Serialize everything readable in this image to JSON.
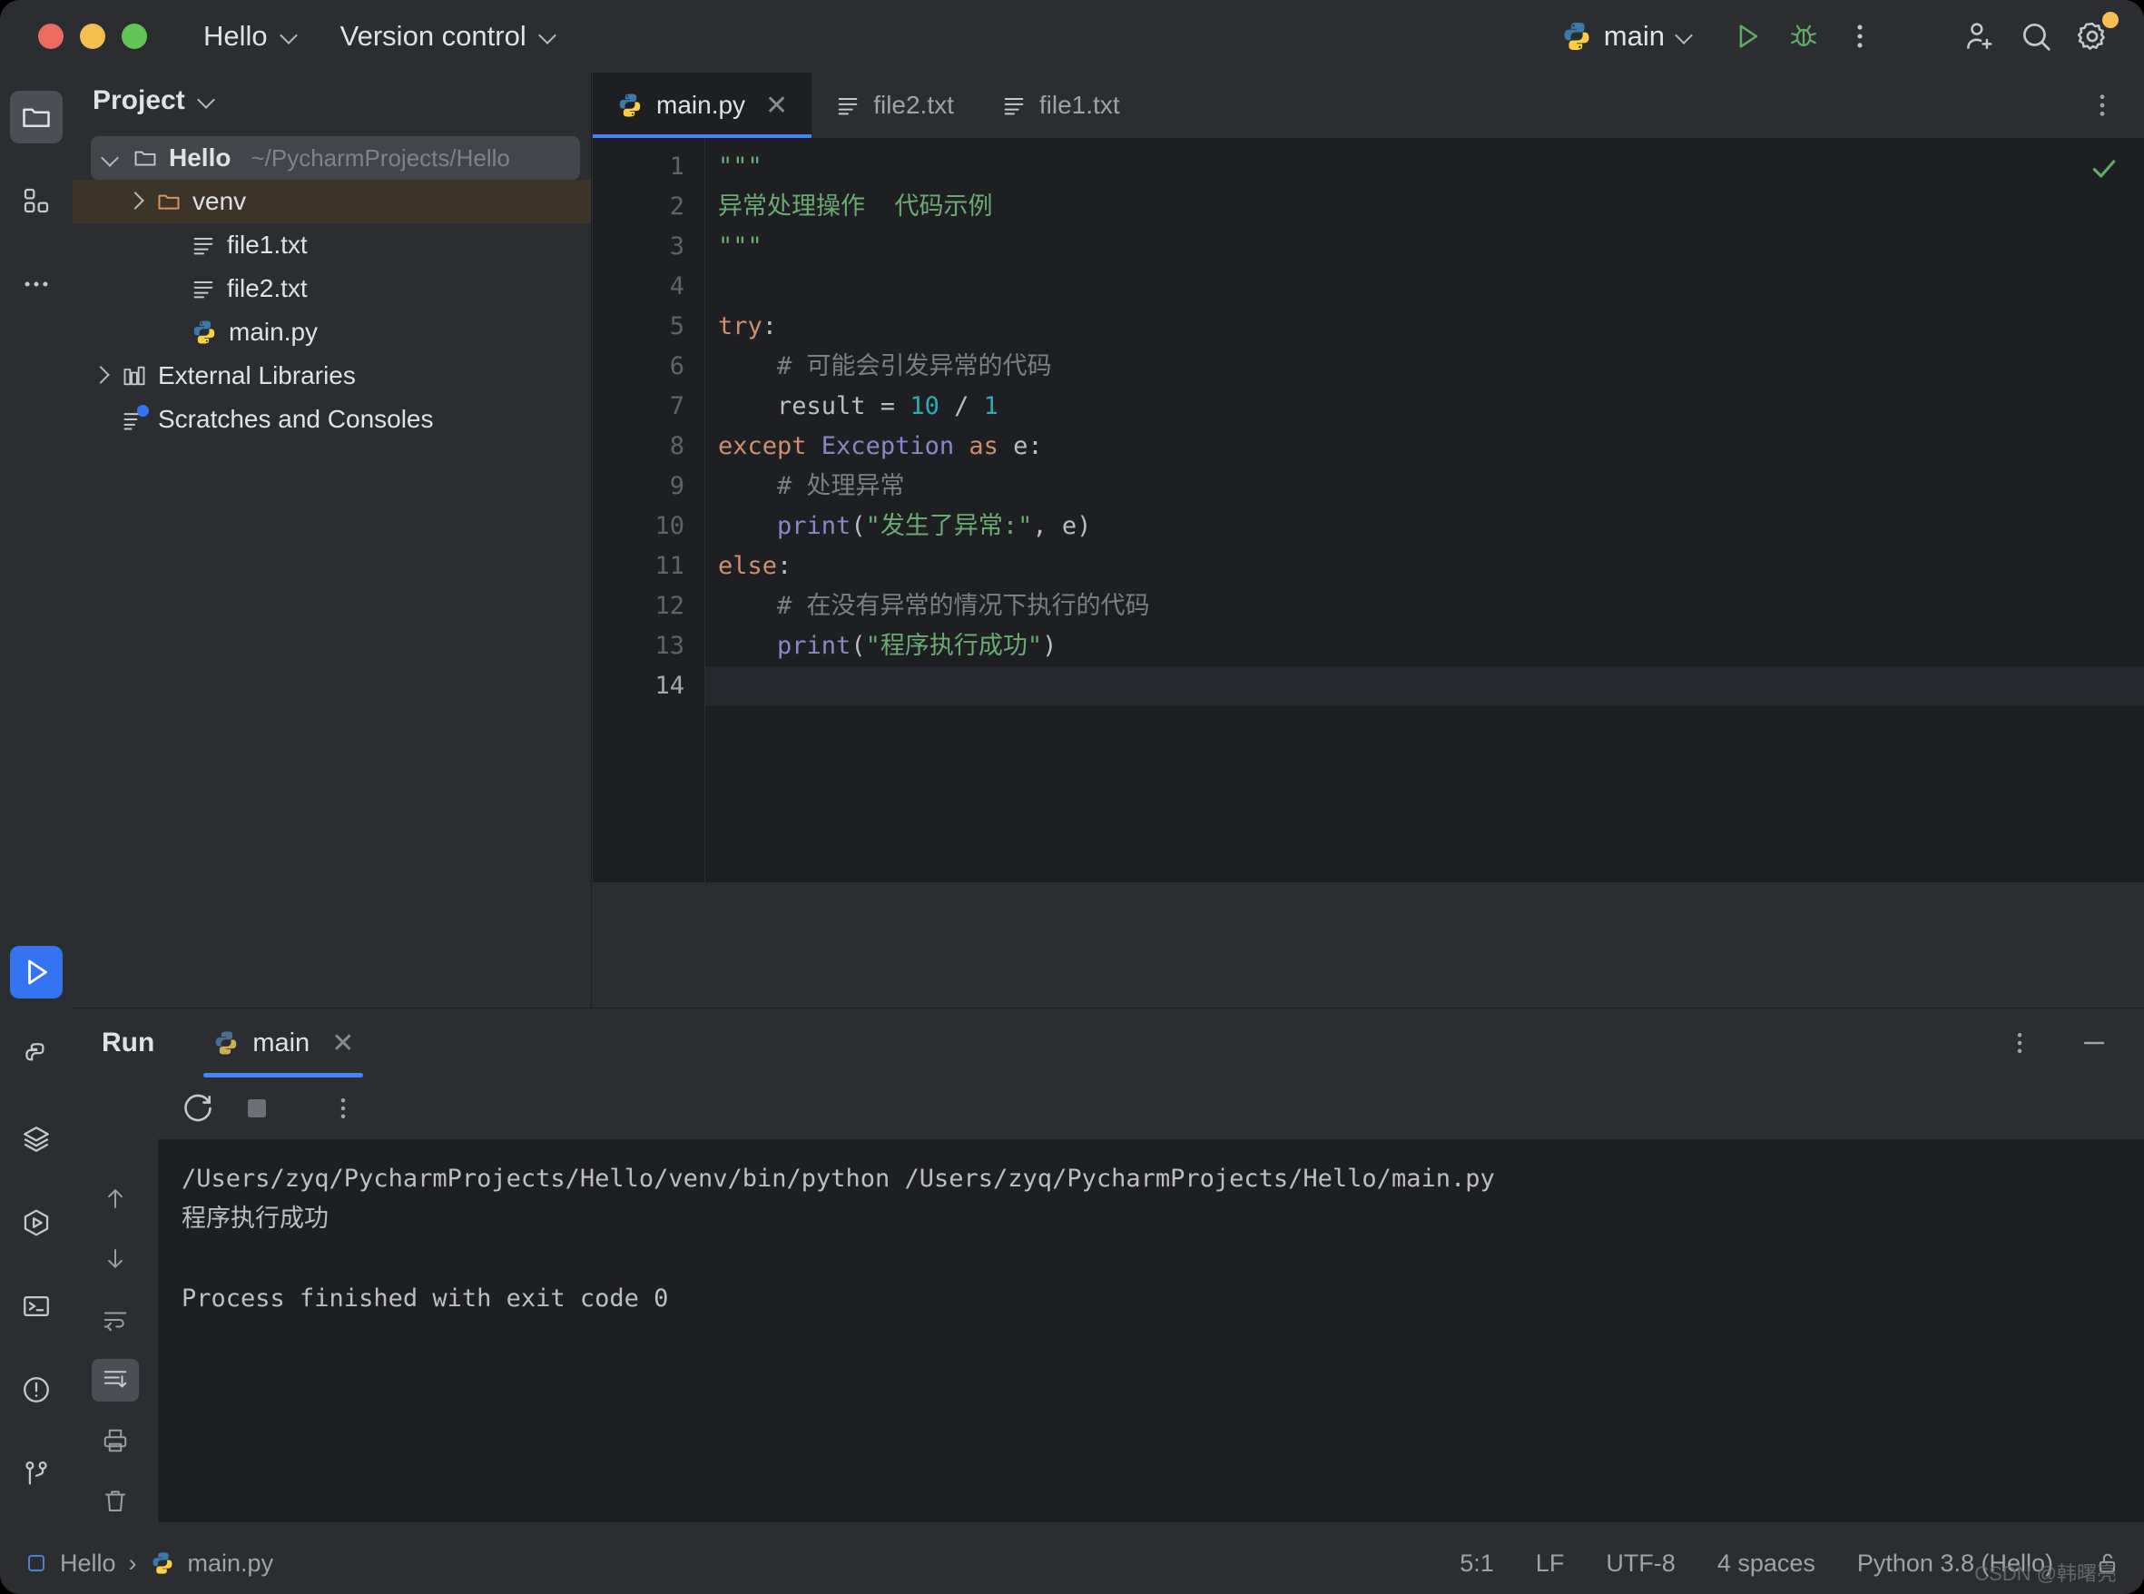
{
  "window": {
    "traffic_lights": [
      "close",
      "minimize",
      "maximize"
    ],
    "project_menu": "Hello",
    "vcs_menu": "Version control",
    "run_config": "main"
  },
  "toolbar_right": {
    "run_icon": "run-icon",
    "debug_icon": "debug-icon",
    "more_icon": "more-vertical-icon",
    "invite_icon": "add-user-icon",
    "search_icon": "search-icon",
    "settings_icon": "gear-icon"
  },
  "rail": {
    "top": [
      {
        "name": "project-tool-window",
        "icon": "folder-icon",
        "active": true
      },
      {
        "name": "structure-tool-window",
        "icon": "grid-icon",
        "active": false
      },
      {
        "name": "more-tool-windows",
        "icon": "ellipsis-icon",
        "active": false
      }
    ],
    "bottom": [
      {
        "name": "run-tool-window",
        "icon": "run-icon",
        "active": true
      },
      {
        "name": "python-packages",
        "icon": "python-icon",
        "active": false
      },
      {
        "name": "database",
        "icon": "layers-icon",
        "active": false
      },
      {
        "name": "services",
        "icon": "services-icon",
        "active": false
      },
      {
        "name": "terminal",
        "icon": "terminal-icon",
        "active": false
      },
      {
        "name": "problems",
        "icon": "warning-circle-icon",
        "active": false
      },
      {
        "name": "version-control",
        "icon": "branch-icon",
        "active": false
      }
    ]
  },
  "project_panel": {
    "title": "Project",
    "tree": [
      {
        "label": "Hello",
        "path": "~/PycharmProjects/Hello",
        "icon": "folder-icon",
        "state": "expanded",
        "depth": 0,
        "selected": true,
        "bold": true
      },
      {
        "label": "venv",
        "path": "",
        "icon": "folder-orange-icon",
        "state": "collapsed",
        "depth": 1,
        "highlighted": true,
        "bold": false
      },
      {
        "label": "file1.txt",
        "path": "",
        "icon": "text-file-icon",
        "state": "leaf",
        "depth": 2,
        "bold": false
      },
      {
        "label": "file2.txt",
        "path": "",
        "icon": "text-file-icon",
        "state": "leaf",
        "depth": 2,
        "bold": false
      },
      {
        "label": "main.py",
        "path": "",
        "icon": "python-icon",
        "state": "leaf",
        "depth": 2,
        "bold": false
      },
      {
        "label": "External Libraries",
        "path": "",
        "icon": "library-icon",
        "state": "collapsed",
        "depth": 0,
        "bold": false
      },
      {
        "label": "Scratches and Consoles",
        "path": "",
        "icon": "scratches-icon",
        "state": "leaf",
        "depth": 0,
        "bold": false
      }
    ]
  },
  "editor": {
    "tabs": [
      {
        "label": "main.py",
        "icon": "python-icon",
        "active": true,
        "closable": true
      },
      {
        "label": "file2.txt",
        "icon": "text-file-icon",
        "active": false,
        "closable": false
      },
      {
        "label": "file1.txt",
        "icon": "text-file-icon",
        "active": false,
        "closable": false
      }
    ],
    "more_icon": "more-vertical-icon",
    "inspection_status": "ok-check-icon",
    "current_line": 14,
    "lines": [
      {
        "n": 1,
        "tokens": [
          {
            "t": "\"\"\"",
            "c": "s"
          }
        ]
      },
      {
        "n": 2,
        "tokens": [
          {
            "t": "异常处理操作  代码示例",
            "c": "s"
          }
        ]
      },
      {
        "n": 3,
        "tokens": [
          {
            "t": "\"\"\"",
            "c": "s"
          }
        ]
      },
      {
        "n": 4,
        "tokens": [
          {
            "t": "",
            "c": ""
          }
        ]
      },
      {
        "n": 5,
        "tokens": [
          {
            "t": "try",
            "c": "k"
          },
          {
            "t": ":",
            "c": ""
          }
        ]
      },
      {
        "n": 6,
        "tokens": [
          {
            "t": "    # 可能会引发异常的代码",
            "c": "c"
          }
        ]
      },
      {
        "n": 7,
        "tokens": [
          {
            "t": "    result = ",
            "c": ""
          },
          {
            "t": "10",
            "c": "n"
          },
          {
            "t": " / ",
            "c": ""
          },
          {
            "t": "1",
            "c": "n"
          }
        ]
      },
      {
        "n": 8,
        "tokens": [
          {
            "t": "except ",
            "c": "k"
          },
          {
            "t": "Exception",
            "c": "cls"
          },
          {
            "t": " as ",
            "c": "k"
          },
          {
            "t": "e:",
            "c": ""
          }
        ]
      },
      {
        "n": 9,
        "tokens": [
          {
            "t": "    # 处理异常",
            "c": "c"
          }
        ]
      },
      {
        "n": 10,
        "tokens": [
          {
            "t": "    ",
            "c": ""
          },
          {
            "t": "print",
            "c": "f"
          },
          {
            "t": "(",
            "c": ""
          },
          {
            "t": "\"发生了异常:\"",
            "c": "s"
          },
          {
            "t": ", e)",
            "c": ""
          }
        ]
      },
      {
        "n": 11,
        "tokens": [
          {
            "t": "else",
            "c": "k"
          },
          {
            "t": ":",
            "c": ""
          }
        ]
      },
      {
        "n": 12,
        "tokens": [
          {
            "t": "    # 在没有异常的情况下执行的代码",
            "c": "c"
          }
        ]
      },
      {
        "n": 13,
        "tokens": [
          {
            "t": "    ",
            "c": ""
          },
          {
            "t": "print",
            "c": "f"
          },
          {
            "t": "(",
            "c": ""
          },
          {
            "t": "\"程序执行成功\"",
            "c": "s"
          },
          {
            "t": ")",
            "c": ""
          }
        ]
      },
      {
        "n": 14,
        "tokens": [
          {
            "t": "",
            "c": ""
          }
        ]
      }
    ]
  },
  "run_panel": {
    "title": "Run",
    "tab_label": "main",
    "tab_icon": "python-icon",
    "tab_close_icon": "close-icon",
    "settings_icon": "more-vertical-icon",
    "minimize_icon": "minimize-icon",
    "toolbar": [
      {
        "name": "rerun-button",
        "icon": "rerun-icon"
      },
      {
        "name": "stop-button",
        "icon": "stop-icon"
      },
      {
        "name": "run-more-button",
        "icon": "more-vertical-icon"
      }
    ],
    "side_toolbar": [
      {
        "name": "scroll-up-button",
        "icon": "arrow-up-icon",
        "selected": false
      },
      {
        "name": "scroll-down-button",
        "icon": "arrow-down-icon",
        "selected": false
      },
      {
        "name": "soft-wrap-button",
        "icon": "wrap-icon",
        "selected": false
      },
      {
        "name": "scroll-to-end-button",
        "icon": "scroll-end-icon",
        "selected": true
      },
      {
        "name": "print-button",
        "icon": "print-icon",
        "selected": false
      },
      {
        "name": "clear-button",
        "icon": "trash-icon",
        "selected": false
      }
    ],
    "console_lines": [
      "/Users/zyq/PycharmProjects/Hello/venv/bin/python /Users/zyq/PycharmProjects/Hello/main.py",
      "程序执行成功",
      "",
      "Process finished with exit code 0"
    ]
  },
  "status_bar": {
    "breadcrumb": [
      {
        "label": "Hello",
        "icon": "module-icon"
      },
      {
        "label": "main.py",
        "icon": "python-icon"
      }
    ],
    "separator": "›",
    "caret_position": "5:1",
    "line_separator": "LF",
    "encoding": "UTF-8",
    "indent": "4 spaces",
    "interpreter": "Python 3.8 (Hello)",
    "lock_icon": "unlocked-icon",
    "watermark": "CSDN @韩曙亮"
  },
  "colors": {
    "bg": "#2b2d30",
    "editor_bg": "#1e1f22",
    "accent_blue": "#3574f0",
    "tab_underline": "#4682fa",
    "keyword": "#cf8e6d",
    "string": "#6aab73",
    "comment": "#7a7e85",
    "number": "#2aacb8",
    "func": "#8888c6",
    "venv_highlight": "#3c3527",
    "selection": "#43454a"
  }
}
